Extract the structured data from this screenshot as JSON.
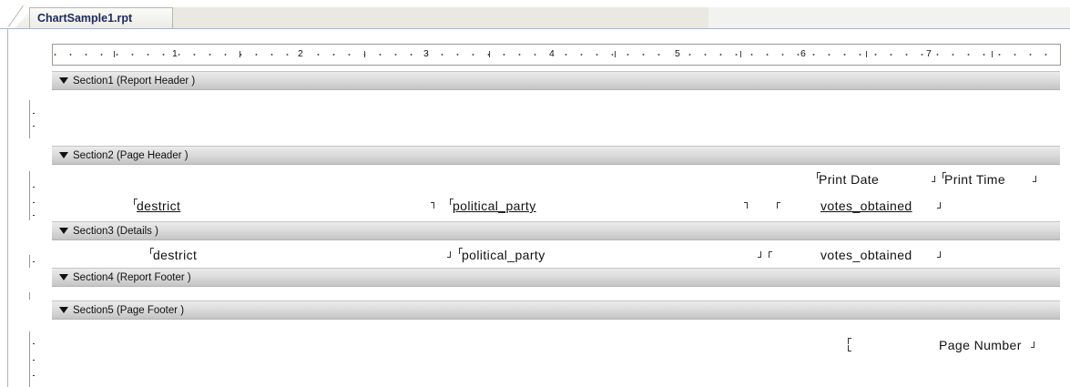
{
  "tab": {
    "title": "ChartSample1.rpt"
  },
  "ruler": {
    "labels": [
      "1",
      "2",
      "3",
      "4",
      "5",
      "6",
      "7"
    ]
  },
  "sections": [
    {
      "label": "Section1 (Report Header )"
    },
    {
      "label": "Section2 (Page Header )"
    },
    {
      "label": "Section3 (Details )"
    },
    {
      "label": "Section4 (Report Footer )"
    },
    {
      "label": "Section5 (Page Footer )"
    }
  ],
  "page_header": {
    "print_date": "Print Date",
    "print_time": "Print Time",
    "col_district": "destrict",
    "col_party": "political_party",
    "col_votes": "votes_obtained"
  },
  "details": {
    "district": "destrict",
    "party": "political_party",
    "votes": "votes_obtained"
  },
  "page_footer": {
    "page_number": "Page Number"
  }
}
